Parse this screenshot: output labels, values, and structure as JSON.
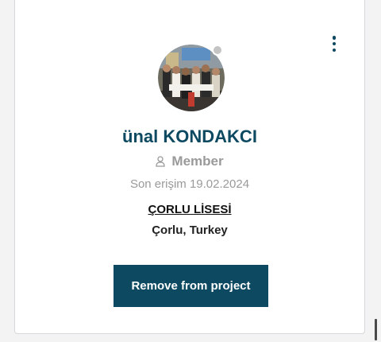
{
  "profile": {
    "name": "ünal KONDAKCI",
    "role": "Member",
    "role_icon": "user-icon",
    "last_access": "Son erişim 19.02.2024",
    "school": "ÇORLU LİSESİ",
    "location": "Çorlu, Turkey",
    "status": "offline"
  },
  "actions": {
    "remove_label": "Remove from project",
    "menu_icon": "kebab-menu-icon"
  },
  "colors": {
    "accent": "#0d4a61",
    "muted_text": "#9a9a9a",
    "status_offline": "#c4c4c4"
  }
}
